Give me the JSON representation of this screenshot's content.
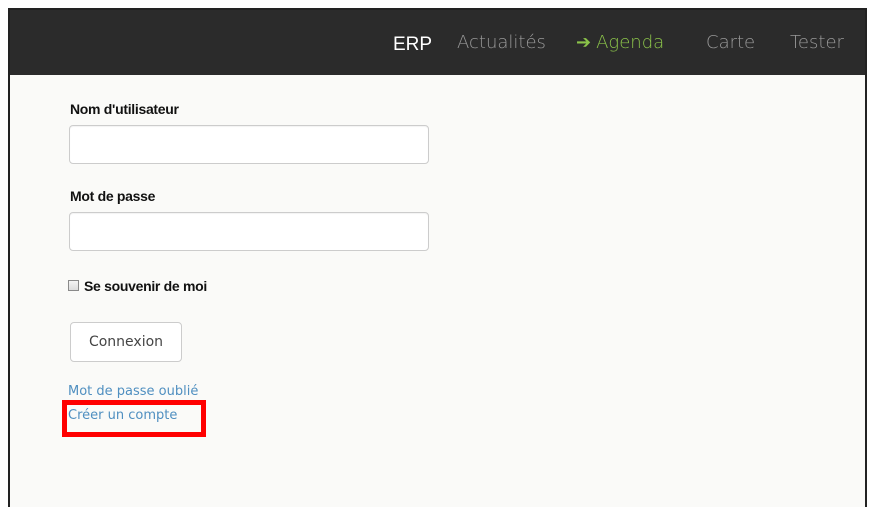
{
  "navbar": {
    "brand": "ERP",
    "items": [
      {
        "label": "Actualités",
        "active": false
      },
      {
        "label": "Agenda",
        "active": true,
        "icon": "arrow-right-icon"
      },
      {
        "label": "Carte",
        "active": false
      },
      {
        "label": "Tester",
        "active": false
      }
    ]
  },
  "login_form": {
    "username_label": "Nom d'utilisateur",
    "username_value": "",
    "password_label": "Mot de passe",
    "password_value": "",
    "remember_label": "Se souvenir de moi",
    "remember_checked": false,
    "submit_label": "Connexion",
    "forgot_password_link": "Mot de passe oublié",
    "create_account_link": "Créer un compte"
  },
  "colors": {
    "navbar_bg": "#2b2b2b",
    "nav_active": "#8bc34a",
    "link": "#4f8fc0",
    "annotation_highlight": "#ff0000"
  },
  "icons": {
    "active_nav_indicator": "arrow-right-icon"
  }
}
